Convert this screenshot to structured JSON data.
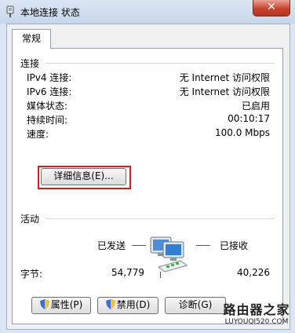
{
  "window": {
    "title": "本地连接 状态",
    "close_glyph": "✕"
  },
  "tabs": [
    {
      "label": "常规"
    }
  ],
  "connection": {
    "section_title": "连接",
    "rows": [
      {
        "label": "IPv4 连接:",
        "value": "无 Internet 访问权限"
      },
      {
        "label": "IPv6 连接:",
        "value": "无 Internet 访问权限"
      },
      {
        "label": "媒体状态:",
        "value": "已启用"
      },
      {
        "label": "持续时间:",
        "value": "00:10:17"
      },
      {
        "label": "速度:",
        "value": "100.0 Mbps"
      }
    ],
    "details_button": "详细信息(E)..."
  },
  "activity": {
    "section_title": "活动",
    "sent_label": "已发送",
    "received_label": "已接收",
    "bytes_label": "字节:",
    "bytes_sent": "54,779",
    "bytes_received": "40,226",
    "network_icon": "network-computers-icon"
  },
  "buttons": {
    "properties": "属性(P)",
    "disable": "禁用(D)",
    "diagnose": "诊断(G)"
  },
  "watermark": {
    "line1": "路由器之家",
    "line2": "LUYOUQI520.COM"
  },
  "colors": {
    "highlight_border": "#cc1f1f",
    "close_button": "#c9442e"
  }
}
